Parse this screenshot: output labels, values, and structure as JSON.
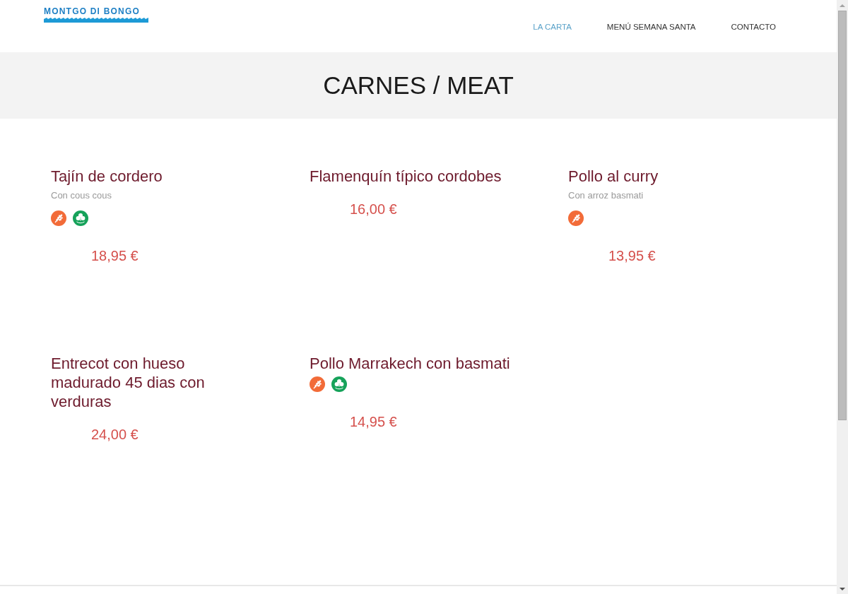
{
  "header": {
    "logo": "MONTGO DI BONGO",
    "nav": [
      {
        "label": "LA CARTA",
        "selected": true
      },
      {
        "label": "MENÚ SEMANA SANTA",
        "selected": false
      },
      {
        "label": "CONTACTO",
        "selected": false
      }
    ]
  },
  "banner": {
    "title": "CARNES / MEAT"
  },
  "dishes": [
    {
      "name": "Tajín de cordero",
      "description": "Con cous cous",
      "allergens": [
        {
          "kind": "wheat",
          "color": "#f26b38"
        },
        {
          "kind": "clover",
          "color": "#16a25a"
        }
      ],
      "price": "18,95 €"
    },
    {
      "name": "Flamenquín típico cordobes",
      "price": "16,00 €"
    },
    {
      "name": "Pollo al curry",
      "description": "Con arroz basmati",
      "allergens": [
        {
          "kind": "wheat",
          "color": "#f26b38"
        }
      ],
      "price": "13,95 €"
    },
    {
      "name": "Entrecot con hueso madurado 45 dias con verduras",
      "price": "24,00 €"
    },
    {
      "name": "Pollo Marrakech con basmati",
      "allergens": [
        {
          "kind": "wheat",
          "color": "#f26b38"
        },
        {
          "kind": "clover",
          "color": "#16a25a"
        }
      ],
      "price": "14,95 €"
    }
  ]
}
